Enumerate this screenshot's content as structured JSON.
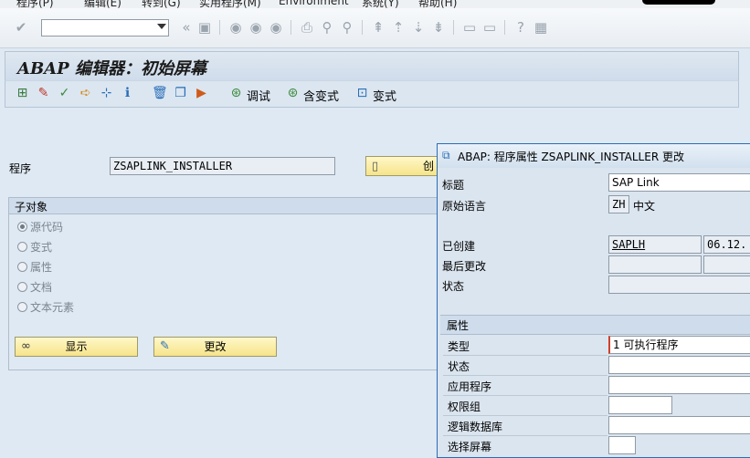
{
  "menu": {
    "items": [
      "程序(P)",
      "编辑(E)",
      "转到(G)",
      "实用程序(M)",
      "Environment",
      "系统(Y)",
      "帮助(H)"
    ]
  },
  "title": "ABAP 编辑器：初始屏幕",
  "app_toolbar": {
    "debug_label": "调试",
    "with_variant_label": "含变式",
    "variant_label": "变式"
  },
  "main": {
    "program_label": "程序",
    "program_value": "ZSAPLINK_INSTALLER",
    "create_label": "创",
    "subobjects": {
      "title": "子对象",
      "options": [
        "源代码",
        "变式",
        "属性",
        "文档",
        "文本元素"
      ],
      "selected": "源代码"
    },
    "display_label": "显示",
    "change_label": "更改"
  },
  "dialog": {
    "title": "ABAP: 程序属性 ZSAPLINK_INSTALLER 更改",
    "title_label": "标题",
    "title_value": "SAP Link",
    "orig_lang_label": "原始语言",
    "orig_lang_code": "ZH",
    "orig_lang_name": "中文",
    "created_label": "已创建",
    "created_user": "SAPLH",
    "created_date": "06.12.",
    "last_changed_label": "最后更改",
    "status_label": "状态",
    "attributes_header": "属性",
    "type_label": "类型",
    "type_value": "1 可执行程序",
    "attr_status_label": "状态",
    "application_label": "应用程序",
    "auth_group_label": "权限组",
    "logical_db_label": "逻辑数据库",
    "selection_screen_label": "选择屏幕"
  },
  "colors": {
    "background": "#dfe9f3",
    "button_yellow": "#f6e48a",
    "dialog_border": "#2a6db6"
  }
}
